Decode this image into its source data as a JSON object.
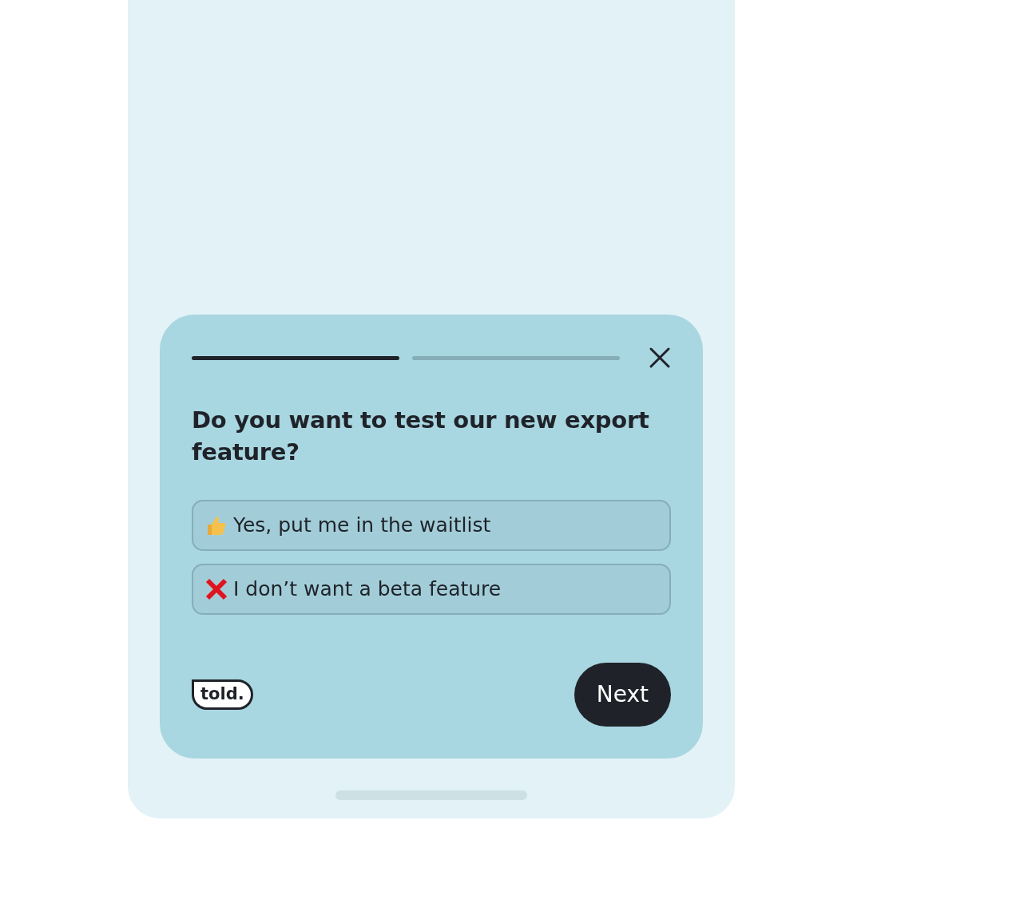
{
  "progress": [
    {
      "done": true
    },
    {
      "done": false
    }
  ],
  "question": "Do you want to test our new export feature?",
  "options": [
    {
      "kind": "thumbs-up",
      "label": "Yes, put me in the waitlist",
      "selected": false
    },
    {
      "kind": "cross",
      "label": "I don’t want a beta feature",
      "selected": false
    }
  ],
  "logo": "told.",
  "next_button": "Next"
}
